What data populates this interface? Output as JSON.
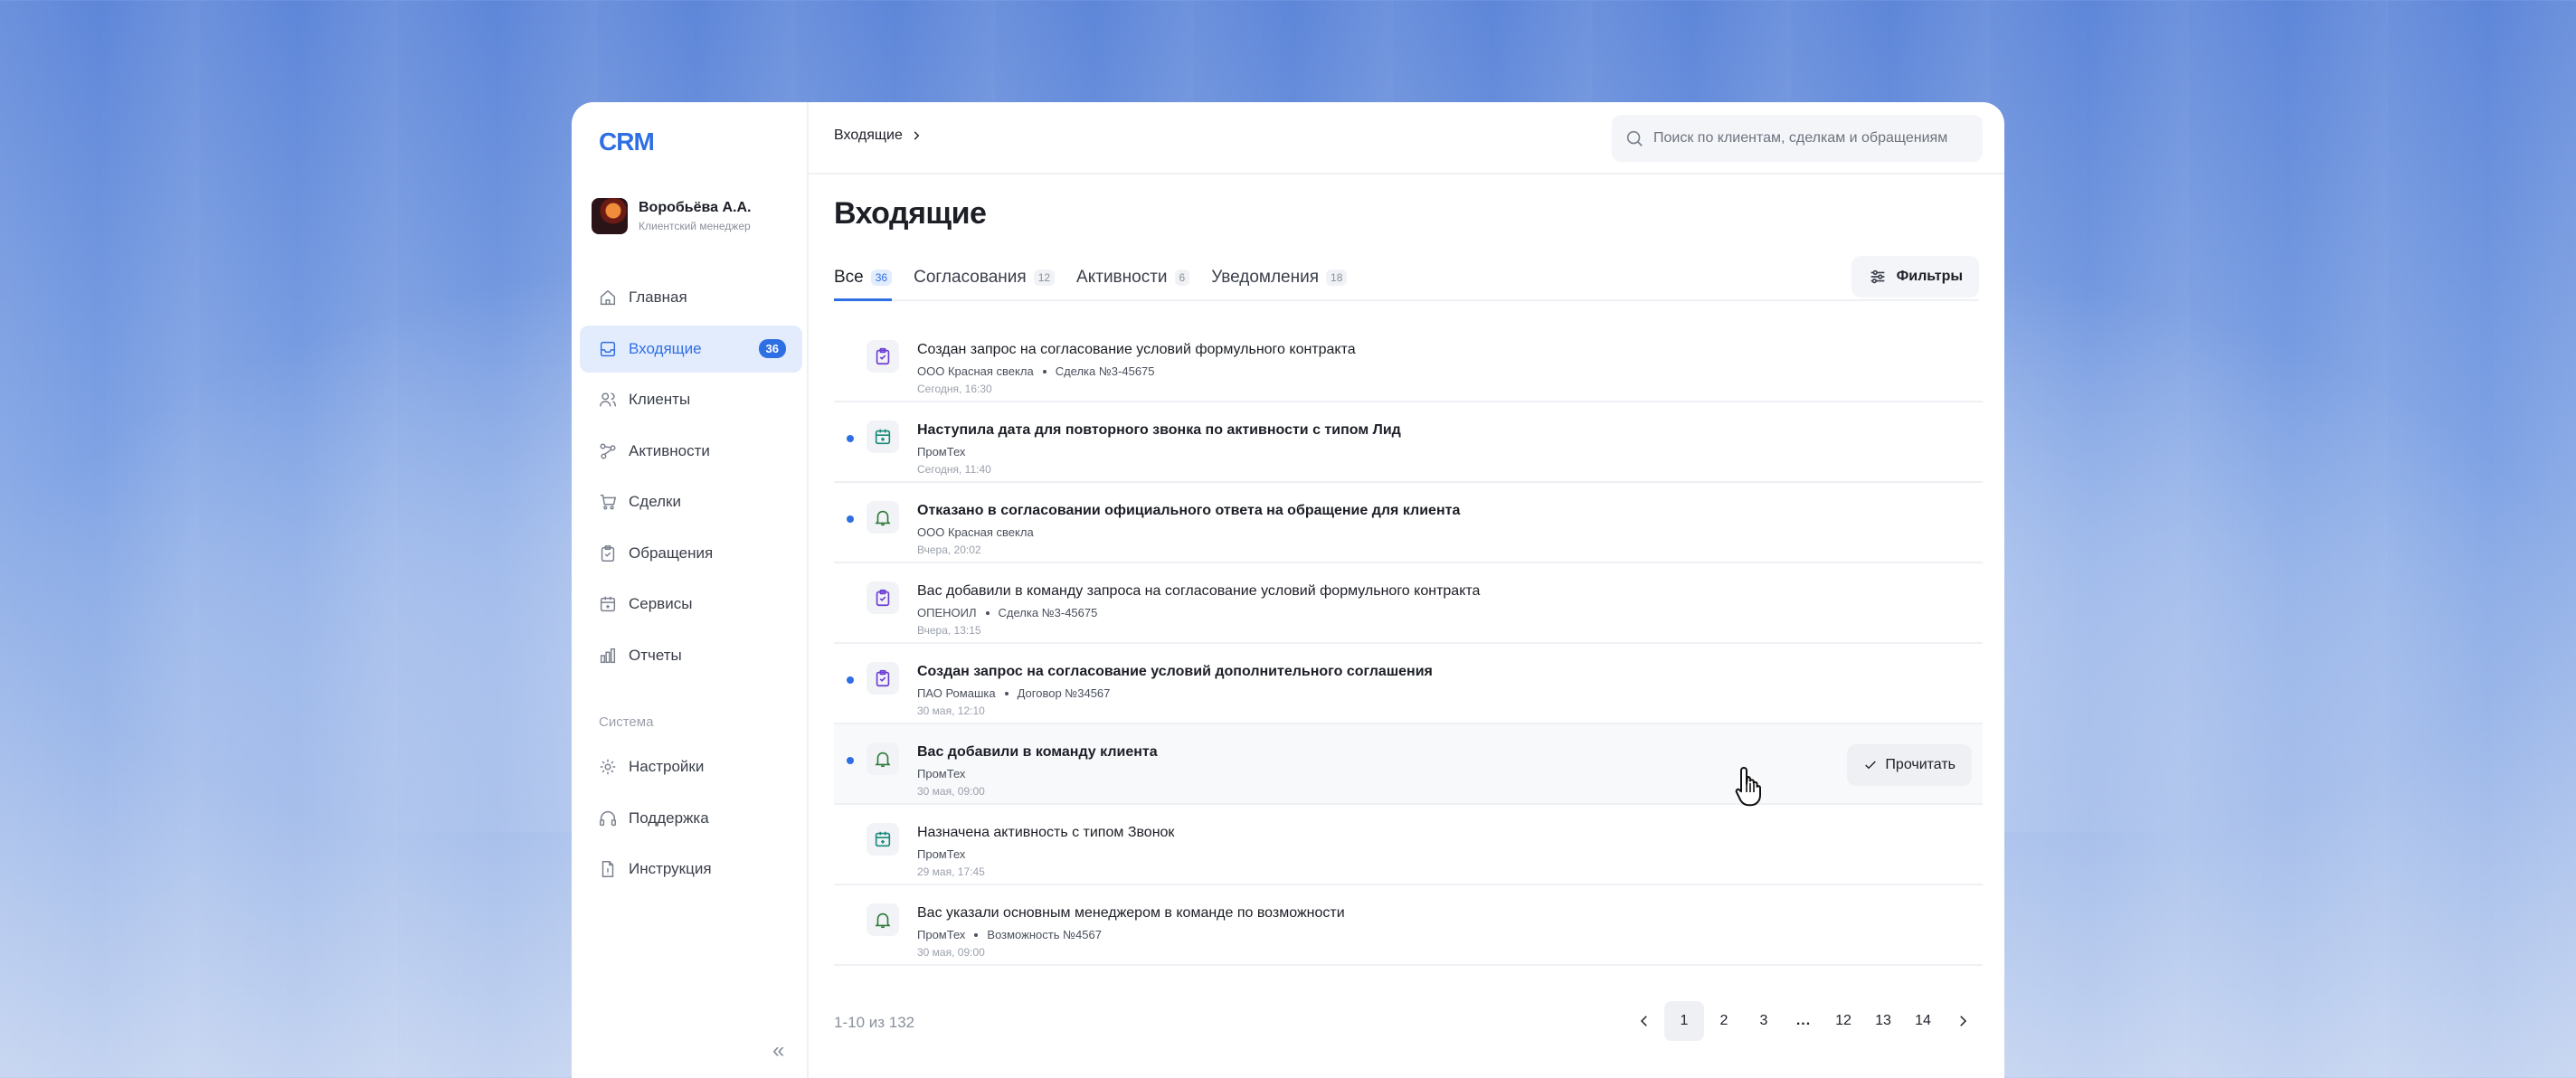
{
  "app": {
    "logo": "CRM"
  },
  "user": {
    "name": "Воробьёва А.А.",
    "role": "Клиентский менеджер"
  },
  "sidebar": {
    "items": [
      {
        "label": "Главная",
        "icon": "home-icon"
      },
      {
        "label": "Входящие",
        "icon": "inbox-icon",
        "badge": "36",
        "active": true
      },
      {
        "label": "Клиенты",
        "icon": "users-icon"
      },
      {
        "label": "Активности",
        "icon": "activity-icon"
      },
      {
        "label": "Сделки",
        "icon": "cart-icon"
      },
      {
        "label": "Обращения",
        "icon": "clipboard-icon"
      },
      {
        "label": "Сервисы",
        "icon": "calendar-icon"
      },
      {
        "label": "Отчеты",
        "icon": "chart-icon"
      }
    ],
    "system_label": "Система",
    "system_items": [
      {
        "label": "Настройки",
        "icon": "gear-icon"
      },
      {
        "label": "Поддержка",
        "icon": "headset-icon"
      },
      {
        "label": "Инструкция",
        "icon": "document-icon"
      }
    ]
  },
  "header": {
    "breadcrumb": "Входящие",
    "search_placeholder": "Поиск по клиентам, сделкам и обращениям"
  },
  "page": {
    "title": "Входящие"
  },
  "tabs": [
    {
      "label": "Все",
      "count": "36",
      "active": true
    },
    {
      "label": "Согласования",
      "count": "12"
    },
    {
      "label": "Активности",
      "count": "6"
    },
    {
      "label": "Уведомления",
      "count": "18"
    }
  ],
  "filters_label": "Фильтры",
  "read_label": "Прочитать",
  "messages": [
    {
      "title": "Создан запрос на согласование условий формульного контракта",
      "org": "ООО Красная свекла",
      "ref": "Сделка №3-45675",
      "time": "Сегодня, 16:30",
      "icon": "clipboard-check-icon",
      "unread": false
    },
    {
      "title": "Наступила дата для повторного звонка по активности с типом Лид",
      "org": "ПромТех",
      "ref": "",
      "time": "Сегодня, 11:40",
      "icon": "calendar-icon",
      "unread": true
    },
    {
      "title": "Отказано в согласовании официального ответа на обращение для клиента",
      "org": "ООО Красная свекла",
      "ref": "",
      "time": "Вчера, 20:02",
      "icon": "bell-icon",
      "unread": true
    },
    {
      "title": "Вас добавили в команду запроса на согласование условий формульного контракта",
      "org": "ОПЕНОИЛ",
      "ref": "Сделка №3-45675",
      "time": "Вчера, 13:15",
      "icon": "clipboard-check-icon",
      "unread": false
    },
    {
      "title": "Создан запрос на согласование условий дополнительного соглашения",
      "org": "ПАО Ромашка",
      "ref": "Договор №34567",
      "time": "30 мая, 12:10",
      "icon": "clipboard-check-icon",
      "unread": true
    },
    {
      "title": "Вас добавили в команду клиента",
      "org": "ПромТех",
      "ref": "",
      "time": "30 мая, 09:00",
      "icon": "bell-icon",
      "unread": true
    },
    {
      "title": "Назначена активность с типом Звонок",
      "org": "ПромТех",
      "ref": "",
      "time": "29 мая, 17:45",
      "icon": "calendar-icon",
      "unread": false
    },
    {
      "title": "Вас указали основным менеджером в команде по возможности",
      "org": "ПромТех",
      "ref": "Возможность №4567",
      "time": "30 мая, 09:00",
      "icon": "bell-icon",
      "unread": false
    }
  ],
  "pagination": {
    "range": "1-10 из 132",
    "pages": [
      "1",
      "2",
      "3",
      "...",
      "12",
      "13",
      "14"
    ],
    "current": "1"
  }
}
